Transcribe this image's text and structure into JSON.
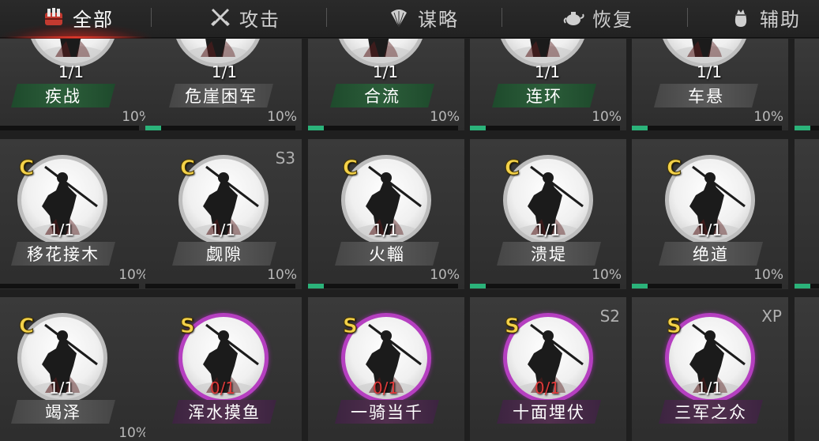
{
  "tabs": [
    {
      "label": "全部",
      "icon": "all-tactics-icon",
      "active": true
    },
    {
      "label": "攻击",
      "icon": "crossed-swords-icon",
      "active": false
    },
    {
      "label": "谋略",
      "icon": "feather-fan-icon",
      "active": false
    },
    {
      "label": "恢复",
      "icon": "teapot-icon",
      "active": false
    },
    {
      "label": "辅助",
      "icon": "pouch-icon",
      "active": false
    }
  ],
  "colors": {
    "accent_active": "#e23a2c",
    "rank_text": "#f4d24a",
    "s_rank_ring": "#b53fc0",
    "progress": "#2bb37a",
    "zero_count": "#e03a3a"
  },
  "rows": [
    {
      "cards": [
        {
          "name": "疾战",
          "count": "1/1",
          "percent": "10%",
          "progress": 0.0,
          "plate": "green"
        },
        {
          "name": "危崖困军",
          "count": "1/1",
          "percent": "10%",
          "progress": 0.1,
          "plate": "gray"
        },
        {
          "name": "合流",
          "count": "1/1",
          "percent": "10%",
          "progress": 0.1,
          "plate": "green"
        },
        {
          "name": "连环",
          "count": "1/1",
          "percent": "10%",
          "progress": 0.1,
          "plate": "green"
        },
        {
          "name": "车悬",
          "count": "1/1",
          "percent": "10%",
          "progress": 0.1,
          "plate": "gray"
        }
      ]
    },
    {
      "cards": [
        {
          "rank": "C",
          "name": "移花接木",
          "count": "1/1",
          "percent": "10%",
          "season": "",
          "progress": 0.0,
          "plate": "gray"
        },
        {
          "rank": "C",
          "name": "觑隙",
          "count": "1/1",
          "percent": "10%",
          "season": "S3",
          "progress": 0.0,
          "plate": "gray"
        },
        {
          "rank": "C",
          "name": "火輜",
          "count": "1/1",
          "percent": "10%",
          "season": "",
          "progress": 0.1,
          "plate": "gray"
        },
        {
          "rank": "C",
          "name": "溃堤",
          "count": "1/1",
          "percent": "10%",
          "season": "",
          "progress": 0.1,
          "plate": "gray"
        },
        {
          "rank": "C",
          "name": "绝道",
          "count": "1/1",
          "percent": "10%",
          "season": "",
          "progress": 0.1,
          "plate": "gray"
        }
      ]
    },
    {
      "cards": [
        {
          "rank": "C",
          "name": "竭泽",
          "count": "1/1",
          "percent": "10%",
          "season": "",
          "plate": "gray",
          "zero": false
        },
        {
          "rank": "S",
          "name": "浑水摸鱼",
          "count": "0/1",
          "percent": "",
          "season": "",
          "plate": "purple",
          "zero": true
        },
        {
          "rank": "S",
          "name": "一骑当千",
          "count": "0/1",
          "percent": "",
          "season": "",
          "plate": "purple",
          "zero": true
        },
        {
          "rank": "S",
          "name": "十面埋伏",
          "count": "0/1",
          "percent": "",
          "season": "S2",
          "plate": "purple",
          "zero": true
        },
        {
          "rank": "S",
          "name": "三军之众",
          "count": "1/1",
          "percent": "",
          "season": "XP",
          "plate": "purple",
          "zero": false
        }
      ]
    }
  ]
}
